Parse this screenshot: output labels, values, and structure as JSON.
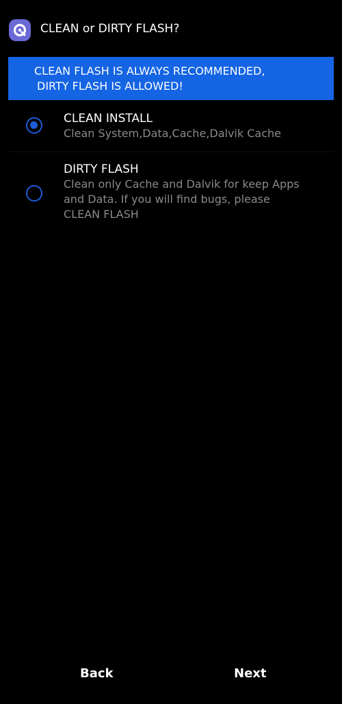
{
  "header": {
    "app_icon": "app-logo-icon",
    "title": "CLEAN or DIRTY FLASH?"
  },
  "banner": {
    "line1": "CLEAN FLASH IS ALWAYS RECOMMENDED,",
    "line2": "DIRTY FLASH IS ALLOWED!",
    "color": "#1464e4"
  },
  "options": [
    {
      "title": "CLEAN INSTALL",
      "description_lines": [
        "Clean System,Data,Cache,Dalvik Cache"
      ],
      "selected": true
    },
    {
      "title": "DIRTY FLASH",
      "description_lines": [
        "Clean only Cache and Dalvik for keep Apps",
        "and Data. If you will find bugs, please",
        "CLEAN FLASH"
      ],
      "selected": false
    }
  ],
  "radio_color": "#1f5bd8",
  "footer": {
    "back_label": "Back",
    "next_label": "Next"
  }
}
